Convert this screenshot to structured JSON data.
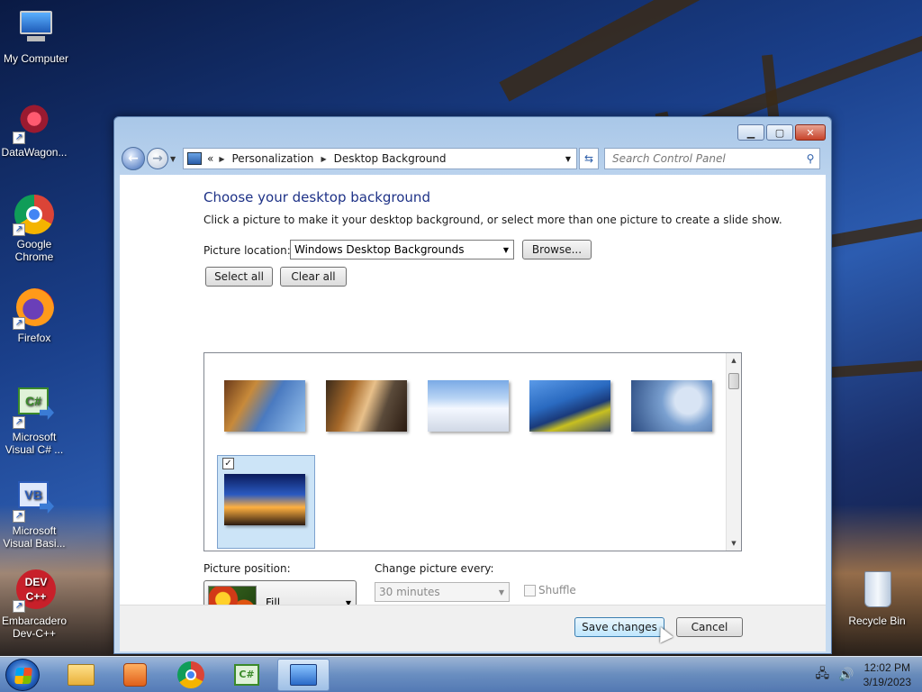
{
  "desktop": {
    "icons": [
      {
        "label": "My Computer"
      },
      {
        "label": "DataWagon..."
      },
      {
        "label": "Google Chrome"
      },
      {
        "label": "Firefox"
      },
      {
        "label": "Microsoft Visual C# ..."
      },
      {
        "label": "Microsoft Visual Basi..."
      },
      {
        "label": "Embarcadero Dev-C++"
      },
      {
        "label": "Recycle Bin"
      }
    ]
  },
  "window": {
    "breadcrumb": [
      "Personalization",
      "Desktop Background"
    ],
    "breadcrumb_prefix": "«",
    "search_placeholder": "Search Control Panel",
    "title": "Choose your desktop background",
    "subtitle": "Click a picture to make it your desktop background, or select more than one picture to create a slide show.",
    "picture_location_label": "Picture location:",
    "picture_location_value": "Windows Desktop Backgrounds",
    "browse_label": "Browse...",
    "select_all_label": "Select all",
    "clear_all_label": "Clear all",
    "thumbnails": [
      {
        "name": "architecture-1",
        "selected": false
      },
      {
        "name": "architecture-2",
        "selected": false
      },
      {
        "name": "architecture-3",
        "selected": false
      },
      {
        "name": "architecture-4",
        "selected": false
      },
      {
        "name": "architecture-5",
        "selected": false
      },
      {
        "name": "architecture-6",
        "selected": true
      }
    ],
    "picture_position_label": "Picture position:",
    "picture_position_value": "Fill",
    "change_every_label": "Change picture every:",
    "change_every_value": "30 minutes",
    "shuffle_label": "Shuffle",
    "save_label": "Save changes",
    "cancel_label": "Cancel"
  },
  "taskbar": {
    "time": "12:02 PM",
    "date": "3/19/2023"
  },
  "icons": {
    "back": "back-arrow-icon",
    "forward": "forward-arrow-icon",
    "search": "search-icon",
    "refresh": "refresh-icon",
    "minimize": "minimize-icon",
    "maximize": "maximize-icon",
    "close": "close-icon"
  }
}
